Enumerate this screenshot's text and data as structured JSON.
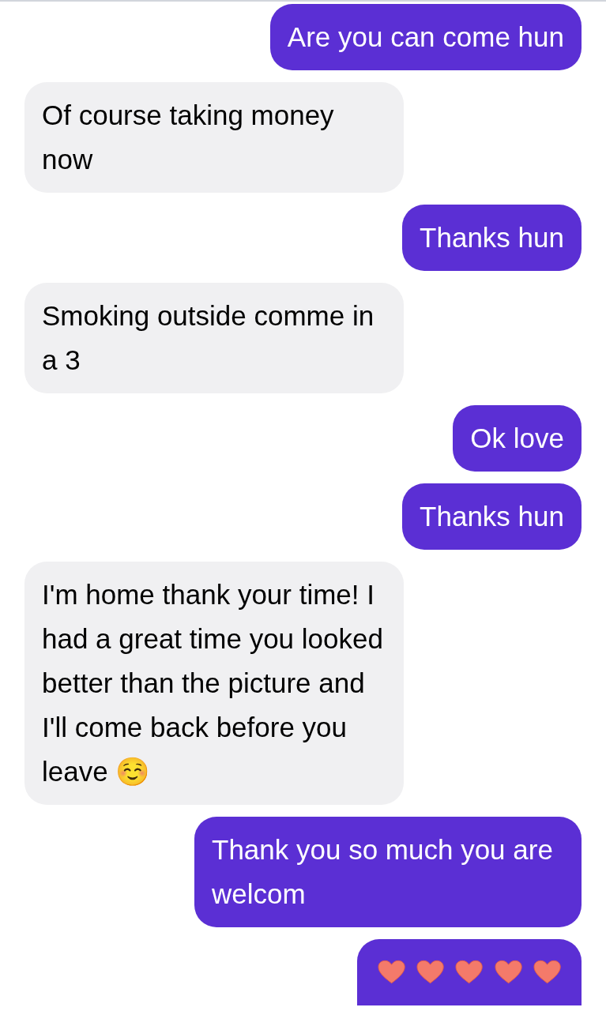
{
  "messages": [
    {
      "kind": "sent",
      "text": "Are you can come hun"
    },
    {
      "kind": "received",
      "text": "Of course taking money now"
    },
    {
      "kind": "sent",
      "text": "Thanks hun"
    },
    {
      "kind": "received",
      "text": "Smoking outside comme in a 3"
    },
    {
      "kind": "sent",
      "text": "Ok love"
    },
    {
      "kind": "sent",
      "text": "Thanks hun"
    },
    {
      "kind": "received",
      "text": "I'm home thank your time! I had a great time you looked better than the picture and I'll come back before you leave ☺️"
    },
    {
      "kind": "sent",
      "text": "Thank you so much you are welcom"
    },
    {
      "kind": "hearts"
    }
  ]
}
